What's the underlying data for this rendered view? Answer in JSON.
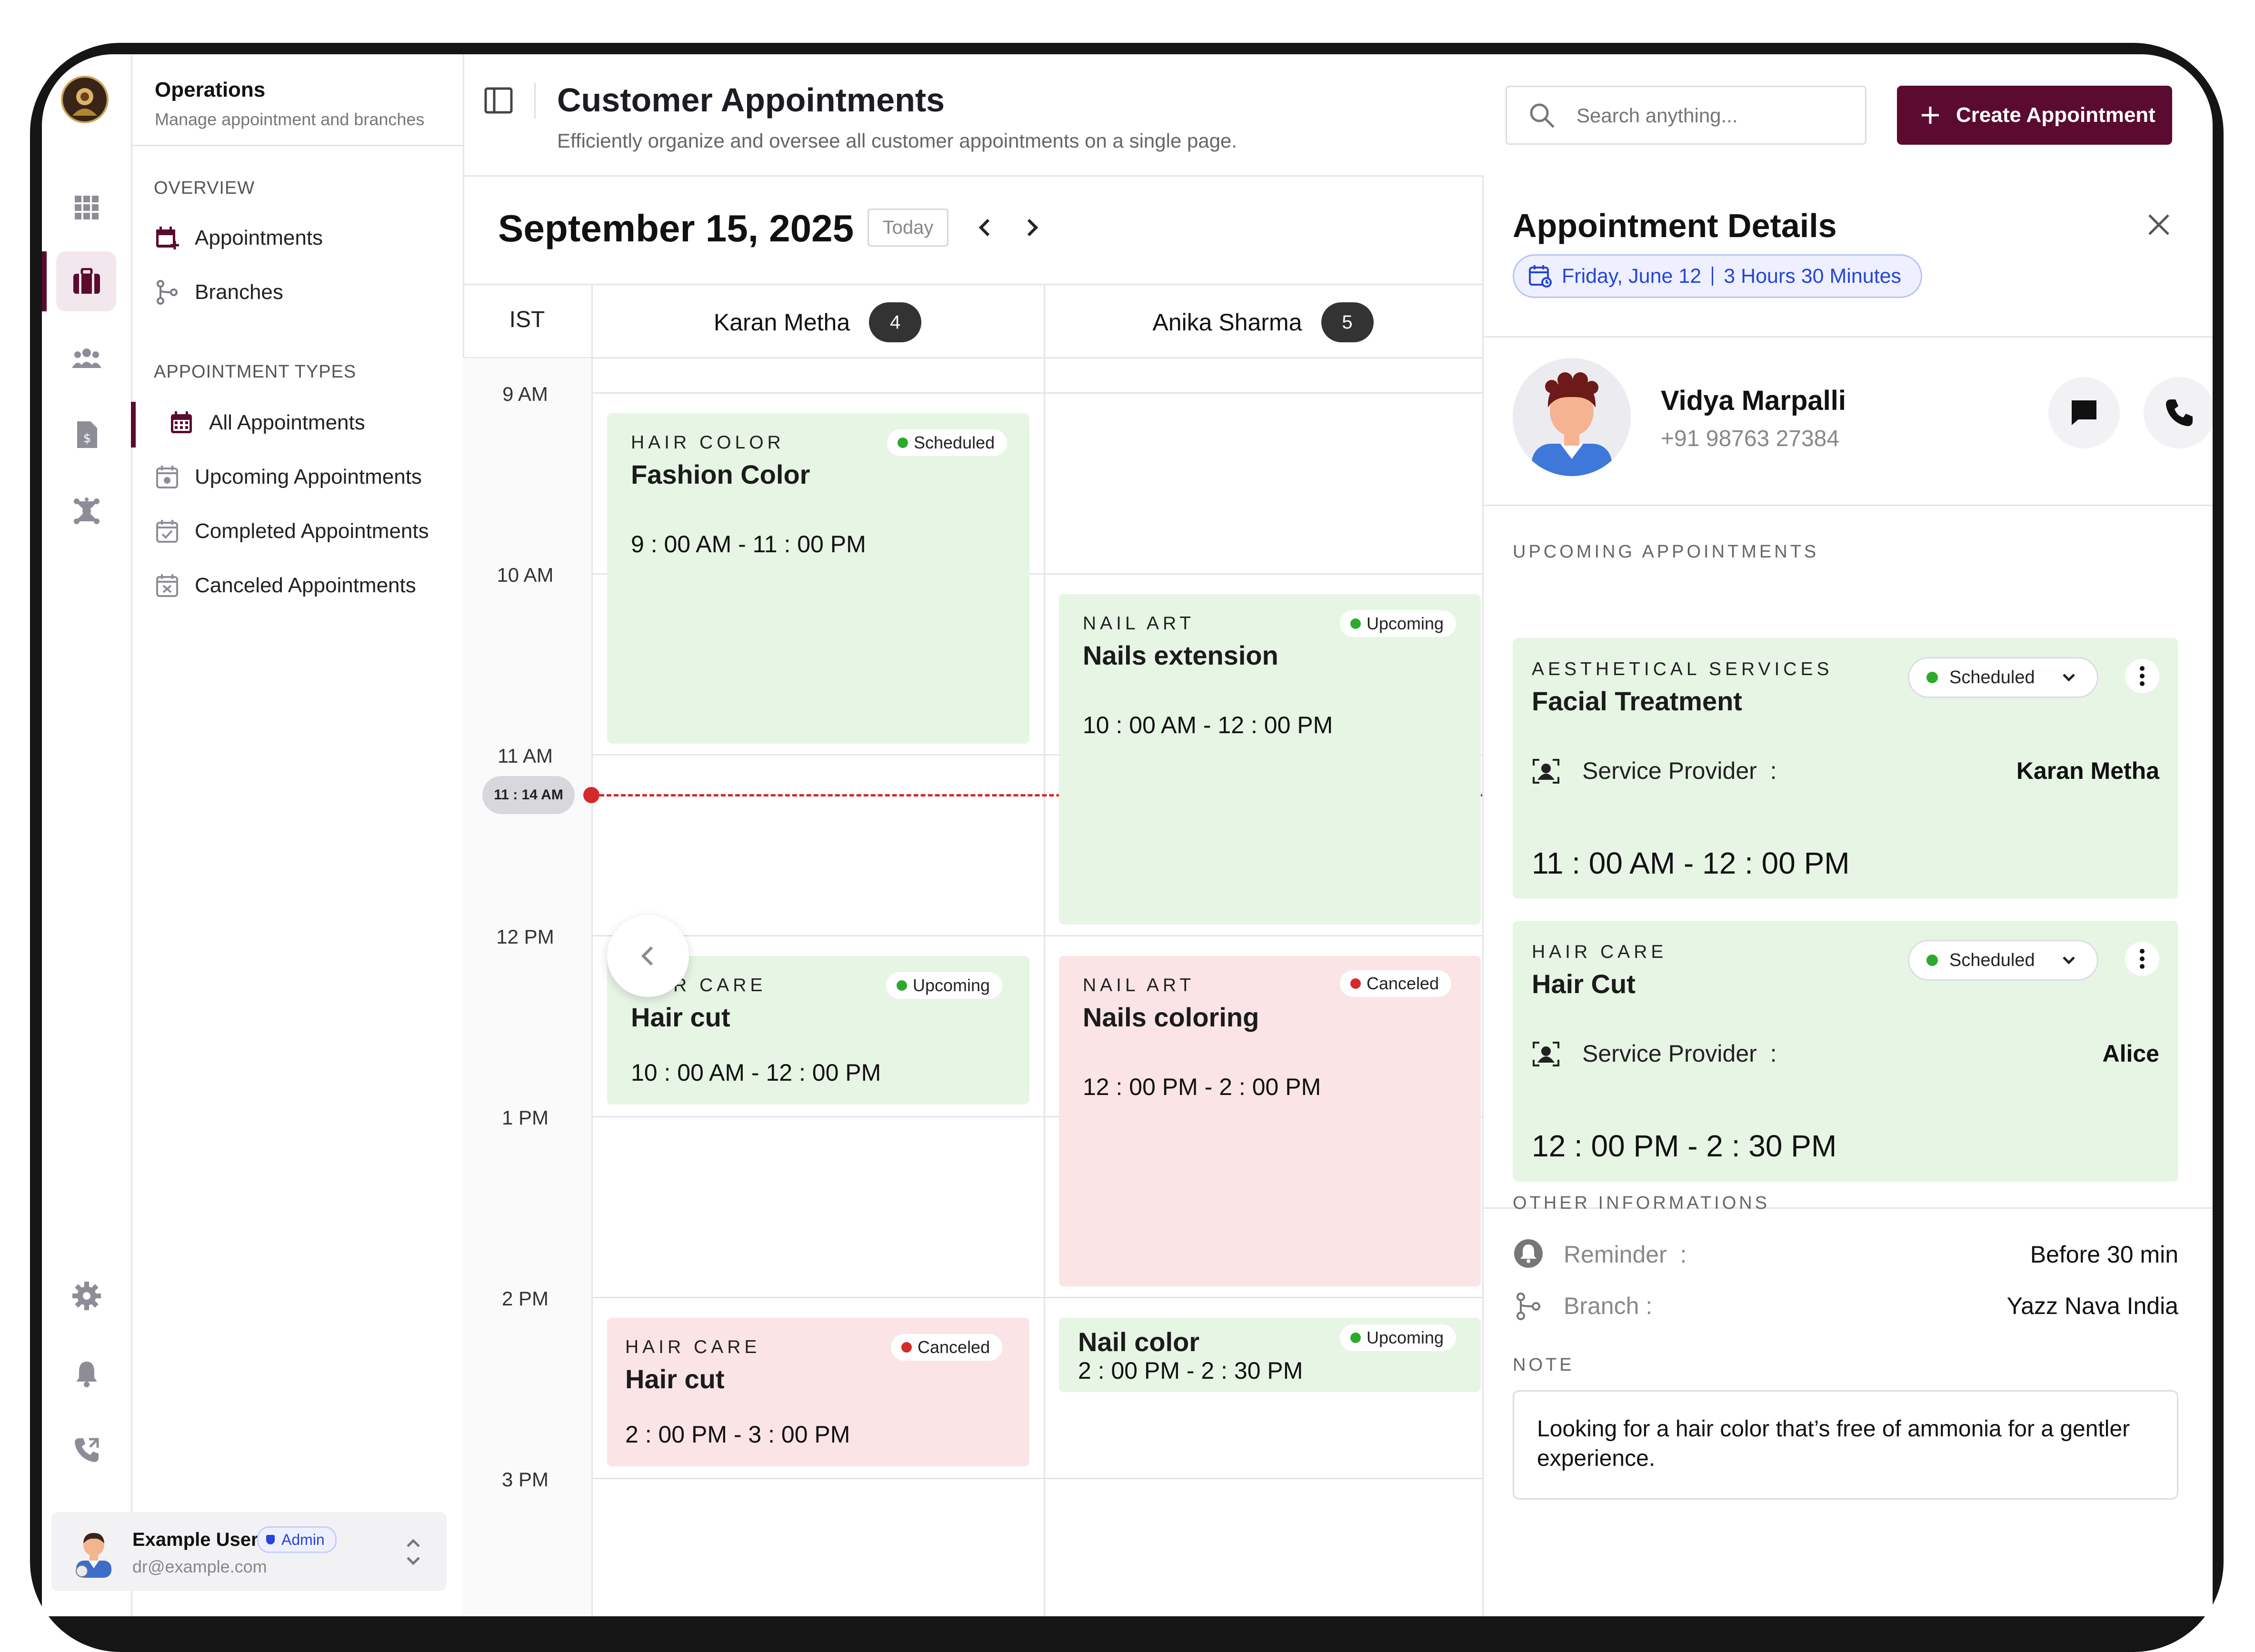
{
  "sidebar": {
    "title": "Operations",
    "subtitle": "Manage appointment and branches",
    "overview_label": "OVERVIEW",
    "overview_items": [
      "Appointments",
      "Branches"
    ],
    "types_label": "APPOINTMENT TYPES",
    "type_items": [
      "All Appointments",
      "Upcoming Appointments",
      "Completed Appointments",
      "Canceled Appointments"
    ],
    "active_item": "All Appointments"
  },
  "user": {
    "name": "Example User",
    "role": "Admin",
    "email": "dr@example.com"
  },
  "header": {
    "title": "Customer Appointments",
    "subtitle": "Efficiently organize and oversee all customer appointments on a single page.",
    "search_placeholder": "Search anything...",
    "create_label": "Create Appointment"
  },
  "calendar": {
    "date": "September 15, 2025",
    "today_label": "Today",
    "timezone": "IST",
    "hours": [
      "9 AM",
      "10 AM",
      "11 AM",
      "12 PM",
      "1 PM",
      "2 PM",
      "3 PM"
    ],
    "current_time": "11 : 14 AM",
    "providers": [
      {
        "name": "Karan Metha",
        "count": "4"
      },
      {
        "name": "Anika Sharma",
        "count": "5"
      }
    ],
    "appointments": [
      {
        "category": "HAIR COLOR",
        "service": "Fashion Color",
        "time": "9 : 00 AM - 11 : 00 PM",
        "status": "Scheduled"
      },
      {
        "category": "NAIL ART",
        "service": "Nails extension",
        "time": "10 : 00 AM - 12 : 00 PM",
        "status": "Upcoming"
      },
      {
        "category": "HAIR CARE",
        "service": "Hair cut",
        "time": "10 : 00 AM - 12 : 00 PM",
        "status": "Upcoming"
      },
      {
        "category": "NAIL ART",
        "service": "Nails coloring",
        "time": "12 : 00 PM - 2 : 00 PM",
        "status": "Canceled"
      },
      {
        "category": "HAIR CARE",
        "service": "Hair cut",
        "time": "2 : 00 PM - 3 : 00 PM",
        "status": "Canceled"
      },
      {
        "category": "",
        "service": "Nail color",
        "time": "2 : 00 PM - 2 : 30 PM",
        "status": "Upcoming"
      }
    ]
  },
  "details": {
    "title": "Appointment Details",
    "date_badge": "Friday, June 12",
    "duration_badge": "3 Hours 30 Minutes",
    "customer_name": "Vidya Marpalli",
    "customer_phone": "+91 98763 27384",
    "upcoming_label": "UPCOMING APPOINTMENTS",
    "upcoming": [
      {
        "category": "AESTHETICAL SERVICES",
        "service": "Facial Treatment",
        "status": "Scheduled",
        "provider_label": "Service Provider  :",
        "provider": "Karan Metha",
        "time": "11 : 00 AM - 12 : 00 PM"
      },
      {
        "category": "HAIR CARE",
        "service": "Hair Cut",
        "status": "Scheduled",
        "provider_label": "Service Provider  :",
        "provider": "Alice",
        "time": "12 : 00 PM - 2 : 30 PM"
      }
    ],
    "other_label": "OTHER INFORMATIONS",
    "reminder_label": "Reminder  :",
    "reminder_value": "Before 30 min",
    "branch_label": "Branch :",
    "branch_value": "Yazz Nava India",
    "note_label": "NOTE",
    "note_text": "Looking for a hair color that’s free of ammonia for a gentler experience."
  },
  "colors": {
    "brand": "#5a0b2f",
    "scheduled_green": "#2bab2b",
    "canceled_red": "#d42a2a",
    "card_green": "#e7f5e5",
    "card_red": "#fbe4e6",
    "badge_blue": "#2545d8",
    "now_line": "#d42a2a"
  },
  "icons": [
    "grid-icon",
    "briefcase-icon",
    "users-icon",
    "invoice-icon",
    "network-icon",
    "gear-icon",
    "bell-icon",
    "phone-forward-icon",
    "calendar-plus-icon",
    "branch-icon",
    "search-icon",
    "plus-icon",
    "sidebar-toggle-icon",
    "chevron-left-icon",
    "chevron-right-icon",
    "close-icon",
    "chat-icon",
    "phone-icon",
    "kebab-icon",
    "provider-icon",
    "reminder-icon"
  ]
}
